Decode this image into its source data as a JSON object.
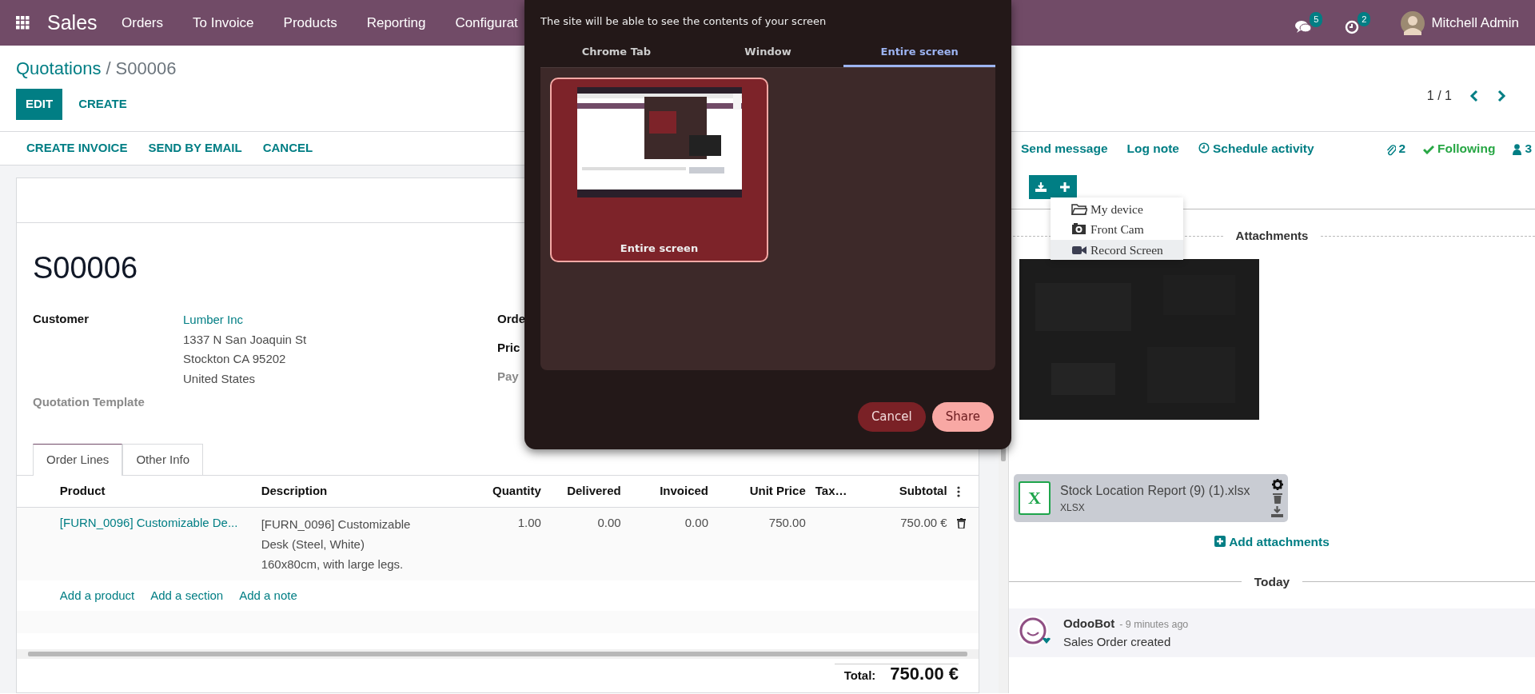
{
  "navbar": {
    "app": "Sales",
    "menu": [
      "Orders",
      "To Invoice",
      "Products",
      "Reporting",
      "Configurat"
    ],
    "messages_badge": "5",
    "activities_badge": "2",
    "user": "Mitchell Admin"
  },
  "breadcrumb": {
    "parent": "Quotations",
    "separator": "/",
    "current": "S00006"
  },
  "control_buttons": [
    {
      "label": "EDIT",
      "kind": "primary"
    },
    {
      "label": "CREATE",
      "kind": "link"
    }
  ],
  "pager": "1 / 1",
  "action_buttons": [
    "CREATE INVOICE",
    "SEND BY EMAIL",
    "CANCEL"
  ],
  "form": {
    "title": "S00006",
    "customer_label": "Customer",
    "customer": "Lumber Inc",
    "address": [
      "1337 N San Joaquin St",
      "Stockton CA 95202",
      "United States"
    ],
    "template_label": "Quotation Template",
    "right_labels": [
      {
        "label": "Orde",
        "kind": "bold"
      },
      {
        "label": "Pric",
        "kind": "bold"
      },
      {
        "label": "Pay",
        "kind": "muted"
      }
    ]
  },
  "notebook": {
    "tabs": [
      {
        "label": "Order Lines",
        "selected": true
      },
      {
        "label": "Other Info",
        "selected": false
      }
    ]
  },
  "table": {
    "columns": [
      "Product",
      "Description",
      "Quantity",
      "Delivered",
      "Invoiced",
      "Unit Price",
      "Tax…",
      "Subtotal"
    ],
    "rows": [
      {
        "product": "[FURN_0096] Customizable De...",
        "description": "[FURN_0096] Customizable Desk (Steel, White)\n160x80cm, with large legs.",
        "quantity": "1.00",
        "delivered": "0.00",
        "invoiced": "0.00",
        "unit_price": "750.00",
        "subtotal": "750.00 €"
      }
    ],
    "add_links": [
      "Add a product",
      "Add a section",
      "Add a note"
    ]
  },
  "total": {
    "label": "Total:",
    "value": "750.00 €"
  },
  "chatter": {
    "actions": [
      "Send message",
      "Log note",
      "Schedule activity"
    ],
    "attachments_count": "2",
    "following": "Following",
    "followers_count": "3",
    "upload_menu": [
      {
        "label": "My device",
        "kind": "folder",
        "selected": false
      },
      {
        "label": "Front Cam",
        "kind": "camera",
        "selected": false
      },
      {
        "label": "Record Screen",
        "kind": "video",
        "selected": true
      }
    ],
    "attachments_title": "Attachments",
    "attachment": {
      "icon_text": "X",
      "name": "Stock Location Report (9) (1).xlsx",
      "type": "XLSX"
    },
    "add_attachments": "Add attachments",
    "today": "Today",
    "message": {
      "author": "OdooBot",
      "time": "- 9 minutes ago",
      "body": "Sales Order created"
    }
  },
  "dialog": {
    "subtitle": "The site will be able to see the contents of your screen",
    "tabs": [
      {
        "label": "Chrome Tab",
        "selected": false
      },
      {
        "label": "Window",
        "selected": false
      },
      {
        "label": "Entire screen",
        "selected": true
      }
    ],
    "source": {
      "label": "Entire screen",
      "selected": true
    },
    "buttons": [
      {
        "label": "Cancel",
        "kind": "secondary"
      },
      {
        "label": "Share",
        "kind": "primary"
      }
    ]
  }
}
